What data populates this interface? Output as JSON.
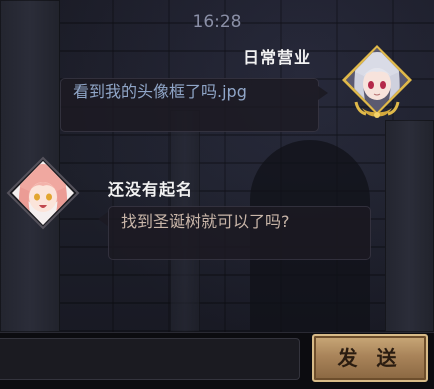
{
  "status": {
    "time": "16:28"
  },
  "messages": [
    {
      "sender": "日常营业",
      "text": "看到我的头像框了吗.jpg",
      "side": "right"
    },
    {
      "sender": "还没有起名",
      "text": "找到圣诞树就可以了吗?",
      "side": "left"
    }
  ],
  "composer": {
    "input_value": "",
    "send_label": "发 送"
  },
  "colors": {
    "bubble_right_text": "#90a6c8",
    "bubble_left_text": "#c9b6a9",
    "send_button": "#b08a5e",
    "frame_gold": "#d4a93c"
  },
  "icons": {
    "avatar_right": "silver-haired-girl-avatar-gold-frame",
    "avatar_left": "pink-haired-girl-avatar"
  }
}
